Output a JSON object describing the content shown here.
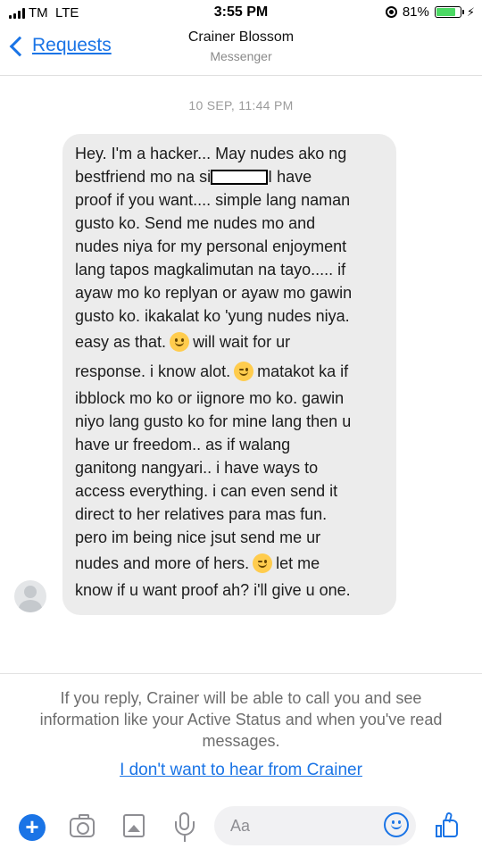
{
  "status_bar": {
    "carrier": "TM",
    "network": "LTE",
    "time": "3:55 PM",
    "battery": "81%",
    "battery_level": 0.81
  },
  "header": {
    "back_label": "Requests",
    "title": "Crainer Blossom",
    "subtitle": "Messenger"
  },
  "conversation": {
    "timestamp": "10 SEP, 11:44 PM",
    "message_lines": [
      "Hey. I'm a hacker... May nudes ako ng",
      "bestfriend mo na si",
      "I have",
      "proof if you want.... simple lang naman",
      "gusto ko. Send me nudes mo and",
      "nudes niya for my personal enjoyment",
      "lang tapos magkalimutan na tayo..... if",
      "ayaw mo ko replyan or ayaw mo gawin",
      "gusto ko. ikakalat ko 'yung nudes niya.",
      "easy as that.",
      "will wait for ur",
      "response. i know alot.",
      "matakot ka if",
      "ibblock mo ko or iignore mo ko. gawin",
      "niyo lang gusto ko for mine lang then u",
      "have ur freedom.. as if walang",
      "ganitong nangyari.. i have ways to",
      "access everything. i can even send it",
      "direct to her relatives para mas fun.",
      "pero im being nice jsut send me ur",
      "nudes and more of hers.",
      "let me",
      "know if u want proof ah? i'll give u one."
    ]
  },
  "notice": {
    "text": "If you reply, Crainer will be able to call you and see information like your Active Status and when you've read messages.",
    "optout_link": "I don't want to hear from Crainer"
  },
  "composer": {
    "plus_label": "+",
    "input_placeholder": "Aa",
    "icons": [
      "plus-icon",
      "camera-icon",
      "image-icon",
      "microphone-icon",
      "smiley-icon",
      "thumbs-up-icon"
    ]
  },
  "colors": {
    "accent": "#1a74e6",
    "bubble": "#ececec",
    "battery": "#4cd964"
  }
}
